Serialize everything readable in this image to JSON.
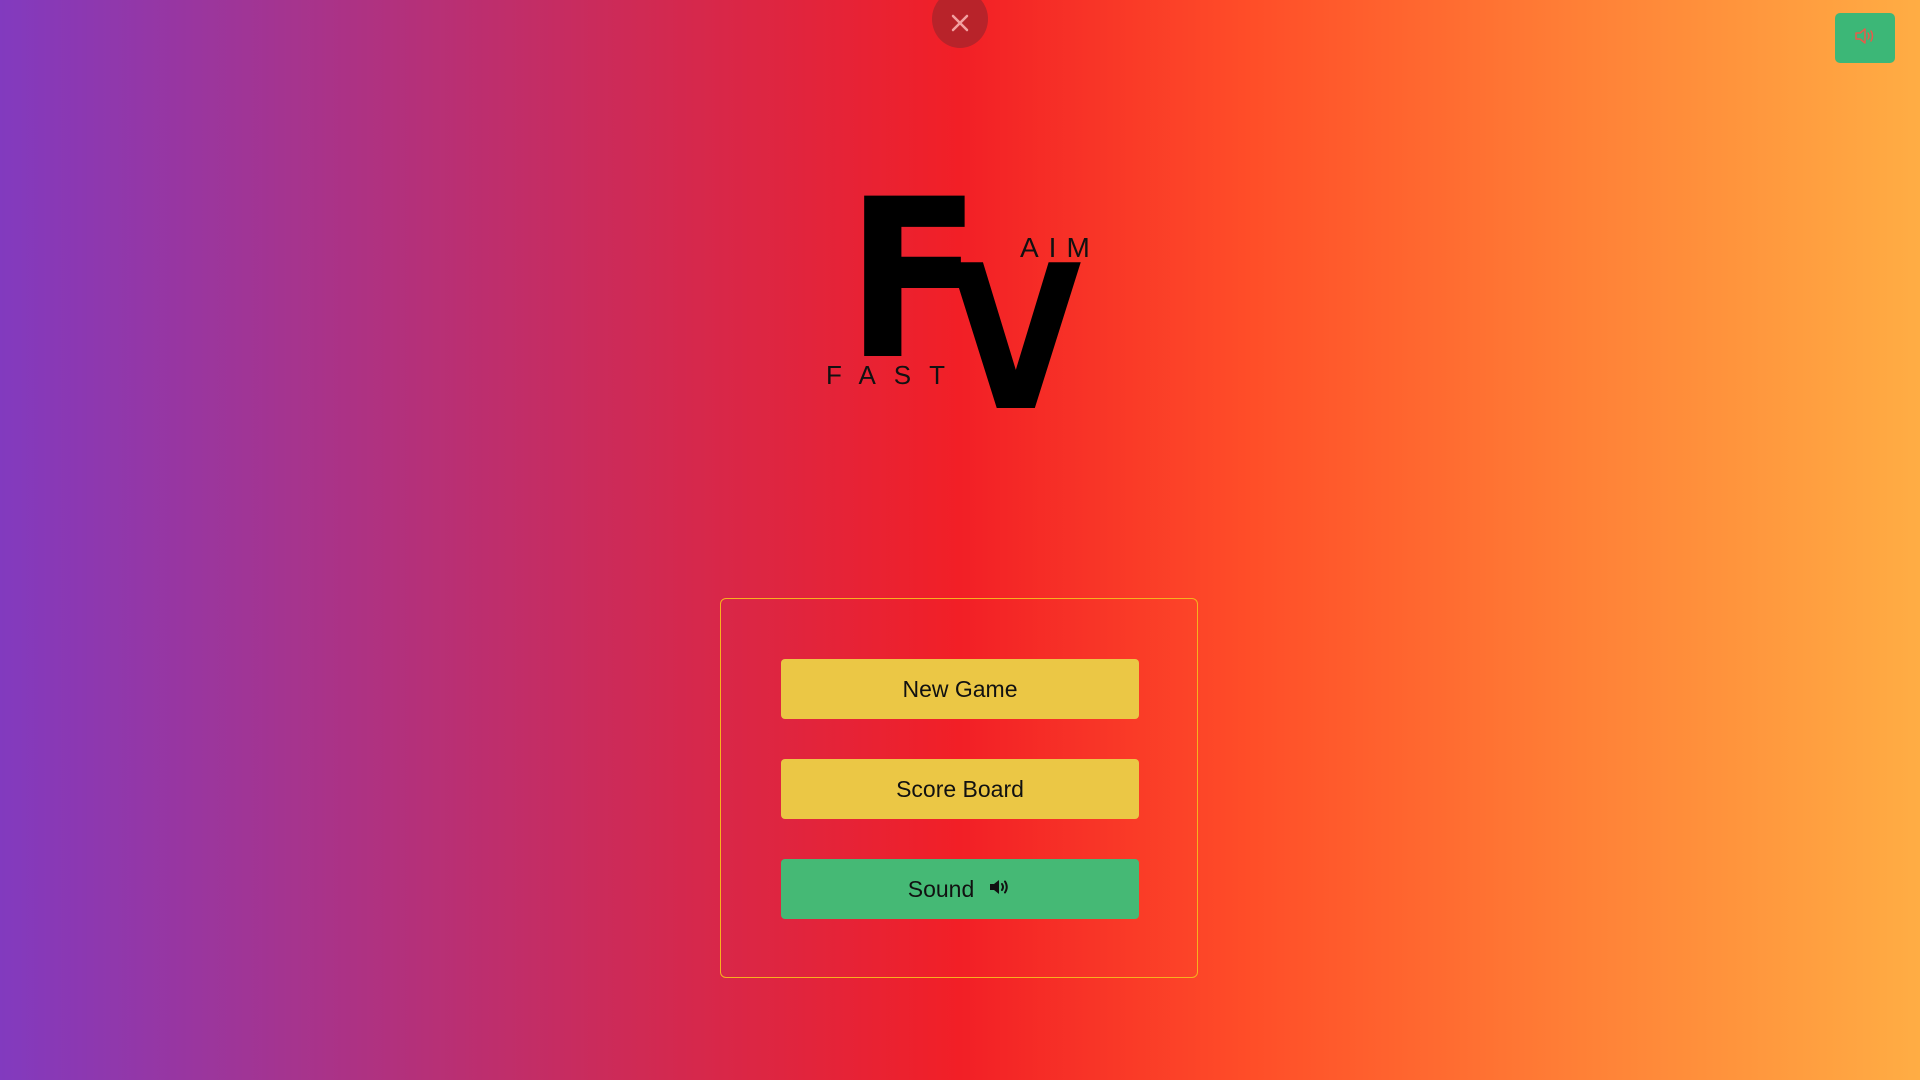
{
  "header": {
    "close_icon": "close-icon",
    "sound_toggle_icon": "speaker-outline-icon"
  },
  "logo": {
    "letter_f": "F",
    "letter_v": "V",
    "word_aim": "AIM",
    "word_fast": "FAST"
  },
  "menu": {
    "new_game": "New Game",
    "score_board": "Score Board",
    "sound": "Sound",
    "sound_icon": "speaker-on-icon"
  },
  "colors": {
    "button_yellow": "#EBC745",
    "button_green": "#45B975",
    "panel_border": "#F7B11E",
    "close_red": "#B8232A"
  }
}
